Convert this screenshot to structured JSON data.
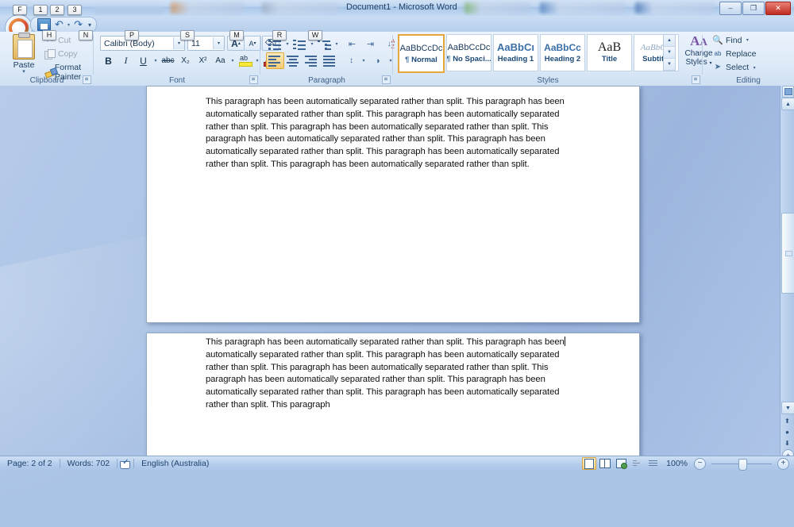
{
  "window": {
    "title": "Document1 - Microsoft Word",
    "minimize_label": "–",
    "restore_label": "❐",
    "close_label": "✕"
  },
  "office_button": {
    "label": "F",
    "keytip": "F"
  },
  "quick_access": {
    "items": [
      {
        "name": "save-button",
        "icon": "save-icon",
        "keytip": "1"
      },
      {
        "name": "undo-button",
        "icon": "undo-icon",
        "glyph": "↶",
        "keytip": "2"
      },
      {
        "name": "redo-button",
        "icon": "redo-icon",
        "glyph": "↷",
        "keytip": "3"
      }
    ],
    "customize_glyph": "▾"
  },
  "tabs": [
    {
      "label": "Home",
      "keytip": "H",
      "active": true
    },
    {
      "label": "Insert",
      "keytip": "N",
      "active": false
    },
    {
      "label": "Page Layout",
      "keytip": "P",
      "active": false
    },
    {
      "label": "References",
      "keytip": "S",
      "active": false
    },
    {
      "label": "Mailings",
      "keytip": "M",
      "active": false
    },
    {
      "label": "Review",
      "keytip": "R",
      "active": false
    },
    {
      "label": "View",
      "keytip": "W",
      "active": false
    }
  ],
  "ribbon": {
    "clipboard": {
      "group_label": "Clipboard",
      "paste_label": "Paste",
      "cut_label": "Cut",
      "copy_label": "Copy",
      "format_painter_label": "Format Painter"
    },
    "font": {
      "group_label": "Font",
      "font_name": "Calibri (Body)",
      "font_size": "11",
      "grow_font": "A",
      "shrink_font": "A",
      "clear_formatting": "clear-formatting-icon",
      "bold": "B",
      "italic": "I",
      "underline": "U",
      "strikethrough": "abc",
      "subscript": "X₂",
      "superscript": "X²",
      "change_case": "Aa",
      "highlight": "highlight-icon",
      "font_color": "A"
    },
    "paragraph": {
      "group_label": "Paragraph",
      "bullets": "bullets-icon",
      "numbering": "numbering-icon",
      "multilevel": "multilevel-list-icon",
      "decrease_indent": "decrease-indent-icon",
      "increase_indent": "increase-indent-icon",
      "sort": "sort-icon",
      "show_marks": "¶",
      "align_left": "align-left-icon",
      "align_center": "align-center-icon",
      "align_right": "align-right-icon",
      "justify": "justify-icon",
      "line_spacing": "line-spacing-icon",
      "shading": "shading-icon",
      "borders": "borders-icon"
    },
    "styles": {
      "group_label": "Styles",
      "gallery": [
        {
          "preview": "AaBbCcDc",
          "name": "Normal",
          "pilcrow": true,
          "active": true
        },
        {
          "preview": "AaBbCcDc",
          "name": "No Spaci...",
          "pilcrow": true,
          "active": false
        },
        {
          "preview": "AaBbCı",
          "name": "Heading 1",
          "pilcrow": false,
          "active": false
        },
        {
          "preview": "AaBbCc",
          "name": "Heading 2",
          "pilcrow": false,
          "active": false
        },
        {
          "preview": "AaB",
          "name": "Title",
          "pilcrow": false,
          "active": false
        },
        {
          "preview": "AaBbCc.",
          "name": "Subtitle",
          "pilcrow": false,
          "active": false
        }
      ],
      "change_styles_label_1": "Change",
      "change_styles_label_2": "Styles"
    },
    "editing": {
      "group_label": "Editing",
      "find_label": "Find",
      "replace_label": "Replace",
      "select_label": "Select"
    }
  },
  "document": {
    "page1_text": "This paragraph has been automatically separated rather than split. This paragraph has been automatically separated rather than split. This paragraph has been automatically separated rather than split. This paragraph has been automatically separated rather than split. This paragraph has been automatically separated rather than split. This paragraph has been automatically separated rather than split. This paragraph has been automatically separated rather than split. This paragraph has been automatically separated rather than split.",
    "page2_text_before_caret": "This paragraph has been automatically separated rather than split. This paragraph has been",
    "page2_text_after_caret": " automatically separated rather than split. This paragraph has been automatically separated rather than split. This paragraph has been automatically separated rather than split. This paragraph has been automatically separated rather than split. This paragraph has been automatically separated rather than split. This paragraph has been automatically separated rather than split. This paragraph"
  },
  "scrollbar": {
    "split_icon": "split-window-icon",
    "up_glyph": "▲",
    "down_glyph": "▼",
    "prev_page_glyph": "⬆",
    "browse_object_glyph": "●",
    "next_page_glyph": "⬇",
    "zoom_plus_glyph": "+"
  },
  "status_bar": {
    "page": "Page: 2 of 2",
    "words": "Words: 702",
    "proofing_icon": "proofing-errors-icon",
    "language": "English (Australia)",
    "views": [
      {
        "name": "print-layout-view",
        "active": true
      },
      {
        "name": "full-screen-reading-view",
        "active": false
      },
      {
        "name": "web-layout-view",
        "active": false
      },
      {
        "name": "outline-view",
        "active": false
      },
      {
        "name": "draft-view",
        "active": false
      }
    ],
    "zoom": "100%",
    "zoom_out": "−",
    "zoom_in": "+"
  },
  "colors": {
    "accent": "#1d4370",
    "selection": "#e8a73c",
    "ribbon_bg": "#eaf2fc",
    "page_bg": "#ffffff"
  }
}
